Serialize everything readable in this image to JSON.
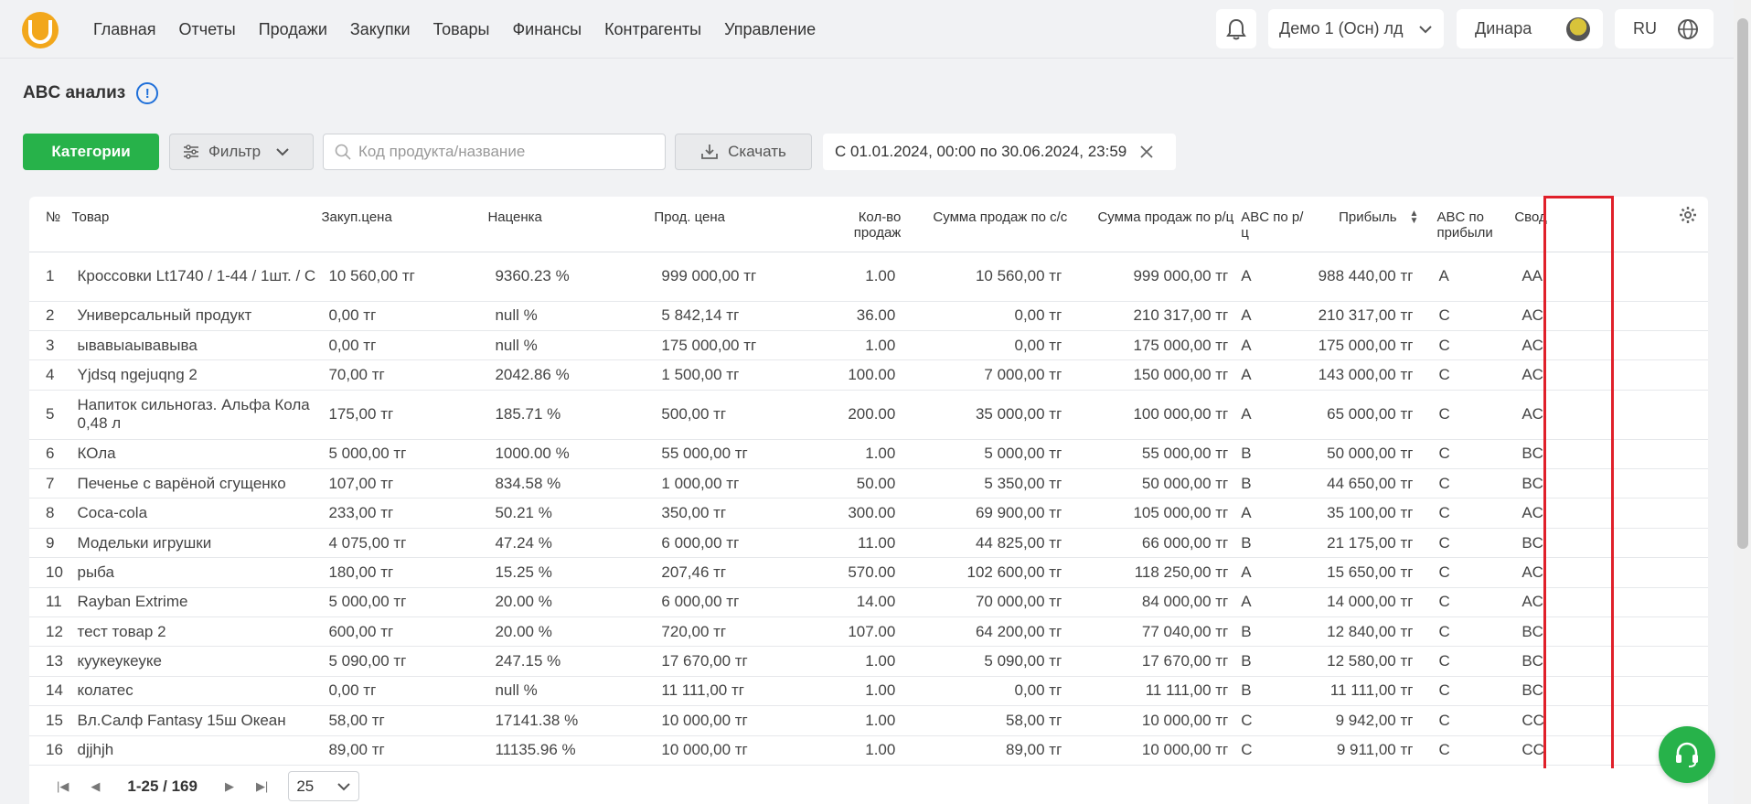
{
  "nav": {
    "items": [
      "Главная",
      "Отчеты",
      "Продажи",
      "Закупки",
      "Товары",
      "Финансы",
      "Контрагенты",
      "Управление"
    ]
  },
  "header": {
    "store": "Демо 1 (Осн) лд",
    "user": "Динара",
    "lang": "RU"
  },
  "page": {
    "title": "ABC анализ",
    "info": "!"
  },
  "toolbar": {
    "categories_label": "Категории",
    "filter_label": "Фильтр",
    "search_placeholder": "Код продукта/название",
    "download_label": "Скачать",
    "date_range": "С 01.01.2024, 00:00 по 30.06.2024, 23:59"
  },
  "table": {
    "columns": [
      "№",
      "Товар",
      "Закуп.цена",
      "Наценка",
      "Прод. цена",
      "Кол-во продаж",
      "Сумма продаж по с/с",
      "Сумма продаж по р/ц",
      "ABC по р/ц",
      "Прибыль",
      "ABC по прибыли",
      "Свод"
    ],
    "rows": [
      [
        "1",
        "Кроссовки Lt1740 / 1-44 / 1шт. / С",
        "10 560,00 тг",
        "9360.23 %",
        "999 000,00 тг",
        "1.00",
        "10 560,00 тг",
        "999 000,00 тг",
        "A",
        "988 440,00 тг",
        "A",
        "AA"
      ],
      [
        "2",
        "Универсальный продукт",
        "0,00 тг",
        "null %",
        "5 842,14 тг",
        "36.00",
        "0,00 тг",
        "210 317,00 тг",
        "A",
        "210 317,00 тг",
        "C",
        "AC"
      ],
      [
        "3",
        "ывавыаывавыва",
        "0,00 тг",
        "null %",
        "175 000,00 тг",
        "1.00",
        "0,00 тг",
        "175 000,00 тг",
        "A",
        "175 000,00 тг",
        "C",
        "AC"
      ],
      [
        "4",
        "Yjdsq ngejuqng 2",
        "70,00 тг",
        "2042.86 %",
        "1 500,00 тг",
        "100.00",
        "7 000,00 тг",
        "150 000,00 тг",
        "A",
        "143 000,00 тг",
        "C",
        "AC"
      ],
      [
        "5",
        "Напиток сильногаз. Альфа Кола 0,48 л",
        "175,00 тг",
        "185.71 %",
        "500,00 тг",
        "200.00",
        "35 000,00 тг",
        "100 000,00 тг",
        "A",
        "65 000,00 тг",
        "C",
        "AC"
      ],
      [
        "6",
        "КОла",
        "5 000,00 тг",
        "1000.00 %",
        "55 000,00 тг",
        "1.00",
        "5 000,00 тг",
        "55 000,00 тг",
        "B",
        "50 000,00 тг",
        "C",
        "BC"
      ],
      [
        "7",
        "Печенье с варёной сгущенко",
        "107,00 тг",
        "834.58 %",
        "1 000,00 тг",
        "50.00",
        "5 350,00 тг",
        "50 000,00 тг",
        "B",
        "44 650,00 тг",
        "C",
        "BC"
      ],
      [
        "8",
        "Coca-cola",
        "233,00 тг",
        "50.21 %",
        "350,00 тг",
        "300.00",
        "69 900,00 тг",
        "105 000,00 тг",
        "A",
        "35 100,00 тг",
        "C",
        "AC"
      ],
      [
        "9",
        "Модельки игрушки",
        "4 075,00 тг",
        "47.24 %",
        "6 000,00 тг",
        "11.00",
        "44 825,00 тг",
        "66 000,00 тг",
        "B",
        "21 175,00 тг",
        "C",
        "BC"
      ],
      [
        "10",
        "рыба",
        "180,00 тг",
        "15.25 %",
        "207,46 тг",
        "570.00",
        "102 600,00 тг",
        "118 250,00 тг",
        "A",
        "15 650,00 тг",
        "C",
        "AC"
      ],
      [
        "11",
        "Rayban Extrime",
        "5 000,00 тг",
        "20.00 %",
        "6 000,00 тг",
        "14.00",
        "70 000,00 тг",
        "84 000,00 тг",
        "A",
        "14 000,00 тг",
        "C",
        "AC"
      ],
      [
        "12",
        "тест товар 2",
        "600,00 тг",
        "20.00 %",
        "720,00 тг",
        "107.00",
        "64 200,00 тг",
        "77 040,00 тг",
        "B",
        "12 840,00 тг",
        "C",
        "BC"
      ],
      [
        "13",
        "куукеукеуке",
        "5 090,00 тг",
        "247.15 %",
        "17 670,00 тг",
        "1.00",
        "5 090,00 тг",
        "17 670,00 тг",
        "B",
        "12 580,00 тг",
        "C",
        "BC"
      ],
      [
        "14",
        "колатес",
        "0,00 тг",
        "null %",
        "11 111,00 тг",
        "1.00",
        "0,00 тг",
        "11 111,00 тг",
        "B",
        "11 111,00 тг",
        "C",
        "BC"
      ],
      [
        "15",
        "Вл.Салф Fantasy 15ш Океан",
        "58,00 тг",
        "17141.38 %",
        "10 000,00 тг",
        "1.00",
        "58,00 тг",
        "10 000,00 тг",
        "C",
        "9 942,00 тг",
        "C",
        "CC"
      ],
      [
        "16",
        "djjhjh",
        "89,00 тг",
        "11135.96 %",
        "10 000,00 тг",
        "1.00",
        "89,00 тг",
        "10 000,00 тг",
        "C",
        "9 911,00 тг",
        "C",
        "CC"
      ]
    ]
  },
  "pagination": {
    "range": "1-25 / 169",
    "page_size": "25"
  },
  "colors": {
    "accent_green": "#27b24a",
    "logo": "#f2a71b",
    "highlight": "#e0202a",
    "info": "#1e6fd9"
  }
}
